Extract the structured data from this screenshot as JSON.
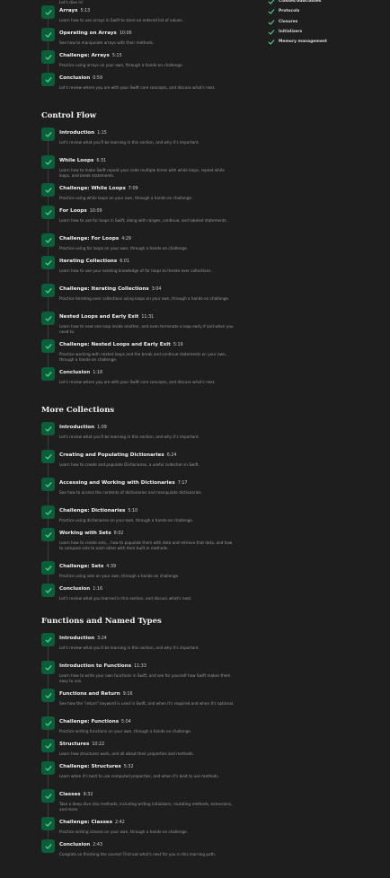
{
  "intro_fragment": {
    "line1": "...",
    "line2": "Let's dive in!"
  },
  "sidebar": [
    {
      "label": "Classes/Subclasses"
    },
    {
      "label": "Protocols"
    },
    {
      "label": "Closures"
    },
    {
      "label": "Initializers"
    },
    {
      "label": "Memory management"
    }
  ],
  "sections": [
    {
      "title": "",
      "lessons": [
        {
          "title": "Arrays",
          "duration": "5:13",
          "desc": "Learn how to use arrays in Swift to store an ordered list of values."
        },
        {
          "title": "Operating on Arrays",
          "duration": "10:06",
          "desc": "See how to manipulate arrays with their methods."
        },
        {
          "title": "Challenge: Arrays",
          "duration": "5:15",
          "desc": "Practice using arrays on your own, through a hands-on challenge."
        },
        {
          "title": "Conclusion",
          "duration": "0:59",
          "desc": "Let's review where you are with your Swift core concepts, and discuss what's next."
        }
      ]
    },
    {
      "title": "Control Flow",
      "lessons": [
        {
          "title": "Introduction",
          "duration": "1:15",
          "desc": "Let's review what you'll be learning in this section, and why it's important."
        },
        {
          "title": "While Loops",
          "duration": "6:31",
          "desc": "Learn how to make Swift repeat your code multiple times with while loops, repeat while loops, and break statements."
        },
        {
          "title": "Challenge: While Loops",
          "duration": "7:09",
          "desc": "Practice using while loops on your own, through a hands-on challenge."
        },
        {
          "title": "For Loops",
          "duration": "10:09",
          "desc": "Learn how to use for loops in Swift, along with ranges, continue, and labeled statements."
        },
        {
          "title": "Challenge: For Loops",
          "duration": "4:29",
          "desc": "Practice using for loops on your own, through a hands-on challenge."
        },
        {
          "title": "Iterating Collections",
          "duration": "6:01",
          "desc": "Learn how to use your existing knowledge of for loops to iterate over collections."
        },
        {
          "title": "Challenge: Iterating Collections",
          "duration": "3:04",
          "desc": "Practice iterating over collections using loops on your own, through a hands-on challenge."
        },
        {
          "title": "Nested Loops and Early Exit",
          "duration": "11:31",
          "desc": "Learn how to next one loop inside another, and even terminate a loop early if and when you need to."
        },
        {
          "title": "Challenge: Nested Loops and Early Exit",
          "duration": "5:19",
          "desc": "Practice working with nested loops and the break and continue statements on your own, through a hands-on challenge."
        },
        {
          "title": "Conclusion",
          "duration": "1:18",
          "desc": "Let's review where you are with your Swift core concepts, and discuss what's next."
        }
      ]
    },
    {
      "title": "More Collections",
      "lessons": [
        {
          "title": "Introduction",
          "duration": "1:09",
          "desc": "Let's review what you'll be learning in this section, and why it's important."
        },
        {
          "title": "Creating and Populating Dictionaries",
          "duration": "6:24",
          "desc": "Learn how to create and populate Dictionaries, a useful collection in Swift."
        },
        {
          "title": "Accessing and Working with Dictionaries",
          "duration": "7:17",
          "desc": "See how to access the contents of dictionaries and manipulate dictionaries."
        },
        {
          "title": "Challenge: Dictionaries",
          "duration": "5:10",
          "desc": "Practice using dictionaries on your own, through a hands-on challenge."
        },
        {
          "title": "Working with Sets",
          "duration": "8:02",
          "desc": "Learn how to create sets, , how to populate them with data and retrieve that data, and how to compare sets to each other with their built-in methods."
        },
        {
          "title": "Challenge: Sets",
          "duration": "4:39",
          "desc": "Practice using sets on your own, through a hands-on challenge."
        },
        {
          "title": "Conclusion",
          "duration": "1:16",
          "desc": "Let's review what you learned in this section, and discuss what's next."
        }
      ]
    },
    {
      "title": "Functions and Named Types",
      "lessons": [
        {
          "title": "Introduction",
          "duration": "3:24",
          "desc": "Let's review what you'll be learning in this section, and why it's important."
        },
        {
          "title": "Introduction to Functions",
          "duration": "11:33",
          "desc": "Learn how to write your own functions in Swift, and see for yourself how Swift makes them easy to use."
        },
        {
          "title": "Functions and Return",
          "duration": "9:16",
          "desc": "See how the \"return\" keyword is used in Swift, and when it's required and when it's optional."
        },
        {
          "title": "Challenge: Functions",
          "duration": "5:04",
          "desc": "Practice writing functions on your own, through a hands-on challenge."
        },
        {
          "title": "Structures",
          "duration": "10:22",
          "desc": "Learn how structures work, and all about their properties and methods."
        },
        {
          "title": "Challenge: Structures",
          "duration": "5:32",
          "desc": "Learn when it's best to use computed properties, and when it's best to use methods."
        },
        {
          "title": "Classes",
          "duration": "9:32",
          "desc": "Take a deep dive into methods, including writing initializers, mutating methods, extensions, and more."
        },
        {
          "title": "Challenge: Classes",
          "duration": "2:42",
          "desc": "Practice writing classes on your own, through a hands-on challenge."
        },
        {
          "title": "Conclusion",
          "duration": "2:43",
          "desc": "Congrats on finishing the course! Find out what's next for you in this learning path."
        }
      ]
    }
  ],
  "colors": {
    "background": "#1e1e1e",
    "check_bg": "#0b5e3a",
    "check_mark": "#4cd98a"
  }
}
